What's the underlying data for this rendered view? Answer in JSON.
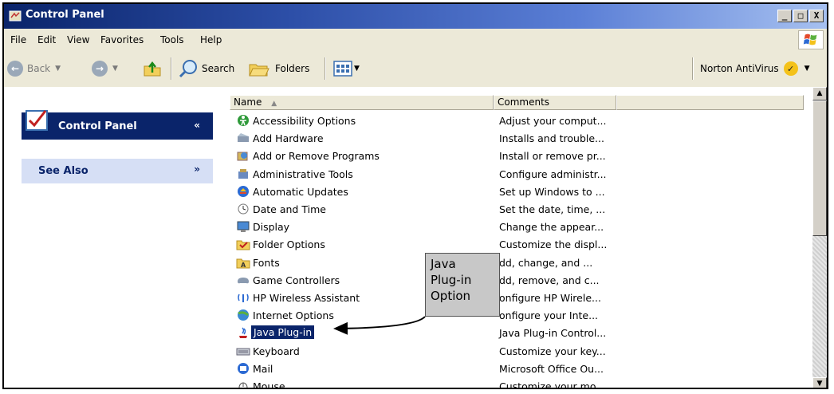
{
  "window": {
    "title": "Control Panel",
    "controls": {
      "minimize": "_",
      "maximize": "□",
      "close": "X"
    }
  },
  "menu": [
    "File",
    "Edit",
    "View",
    "Favorites",
    "Tools",
    "Help"
  ],
  "toolbar": {
    "back_label": "Back",
    "search_label": "Search",
    "folders_label": "Folders",
    "norton_label": "Norton AntiVirus"
  },
  "leftpane": {
    "control_panel_label": "Control Panel",
    "see_also_label": "See Also"
  },
  "list": {
    "columns": {
      "name": "Name",
      "comments": "Comments"
    },
    "items": [
      {
        "name": "Accessibility Options",
        "comment": "Adjust your comput...",
        "icon": "accessibility-icon"
      },
      {
        "name": "Add Hardware",
        "comment": "Installs and trouble...",
        "icon": "add-hardware-icon"
      },
      {
        "name": "Add or Remove Programs",
        "comment": "Install or remove pr...",
        "icon": "add-remove-programs-icon"
      },
      {
        "name": "Administrative Tools",
        "comment": "Configure administr...",
        "icon": "administrative-tools-icon"
      },
      {
        "name": "Automatic Updates",
        "comment": "Set up Windows to ...",
        "icon": "automatic-updates-icon"
      },
      {
        "name": "Date and Time",
        "comment": "Set the date, time, ...",
        "icon": "date-time-icon"
      },
      {
        "name": "Display",
        "comment": "Change the appear...",
        "icon": "display-icon"
      },
      {
        "name": "Folder Options",
        "comment": "Customize the displ...",
        "icon": "folder-options-icon"
      },
      {
        "name": "Fonts",
        "comment": "dd, change, and ...",
        "icon": "fonts-icon"
      },
      {
        "name": "Game Controllers",
        "comment": "dd, remove, and c...",
        "icon": "game-controllers-icon"
      },
      {
        "name": "HP Wireless Assistant",
        "comment": "onfigure HP Wirele...",
        "icon": "hp-wireless-icon"
      },
      {
        "name": "Internet Options",
        "comment": "onfigure your Inte...",
        "icon": "internet-options-icon"
      },
      {
        "name": "Java Plug-in",
        "comment": "Java Plug-in Control...",
        "icon": "java-icon",
        "selected": true
      },
      {
        "name": "Keyboard",
        "comment": "Customize your key...",
        "icon": "keyboard-icon"
      },
      {
        "name": "Mail",
        "comment": "Microsoft Office Ou...",
        "icon": "mail-icon"
      },
      {
        "name": "Mouse",
        "comment": "Customize your mo...",
        "icon": "mouse-icon"
      }
    ]
  },
  "callout": {
    "lines": [
      "Java",
      "Plug-in",
      "Option"
    ]
  },
  "colors": {
    "titlebar": "#0a246a",
    "selection": "#0a246a",
    "chrome": "#ece9d8"
  }
}
